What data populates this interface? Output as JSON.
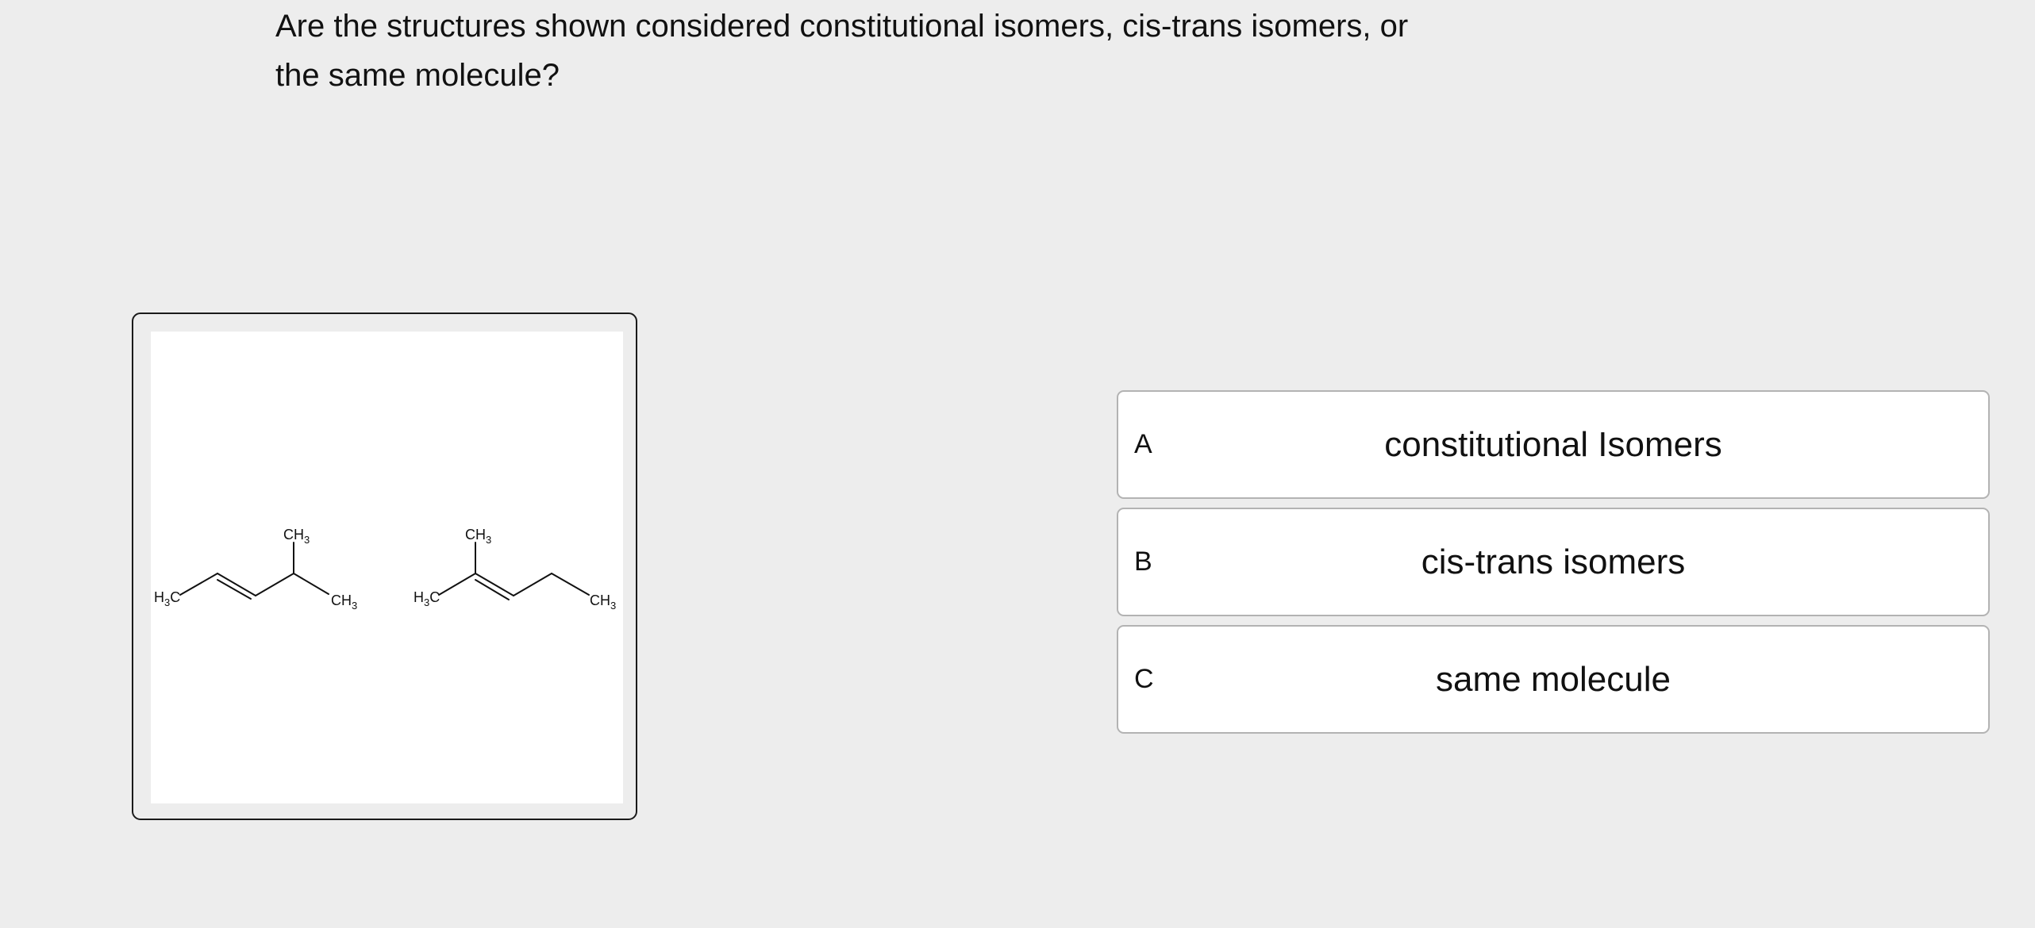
{
  "question": {
    "line1": "Are the structures shown considered constitutional isomers, cis-trans isomers, or",
    "line2": "the same molecule?"
  },
  "structures": {
    "left": {
      "top_label": {
        "main": "CH",
        "sub": "3"
      },
      "left_label": {
        "main": "H",
        "sub": "3",
        "tail": "C"
      },
      "right_label": {
        "main": "CH",
        "sub": "3"
      }
    },
    "right": {
      "top_label": {
        "main": "CH",
        "sub": "3"
      },
      "left_label": {
        "main": "H",
        "sub": "3",
        "tail": "C"
      },
      "right_label": {
        "main": "CH",
        "sub": "3"
      }
    }
  },
  "options": [
    {
      "letter": "A",
      "text": "constitutional Isomers"
    },
    {
      "letter": "B",
      "text": "cis-trans isomers"
    },
    {
      "letter": "C",
      "text": "same molecule"
    }
  ]
}
